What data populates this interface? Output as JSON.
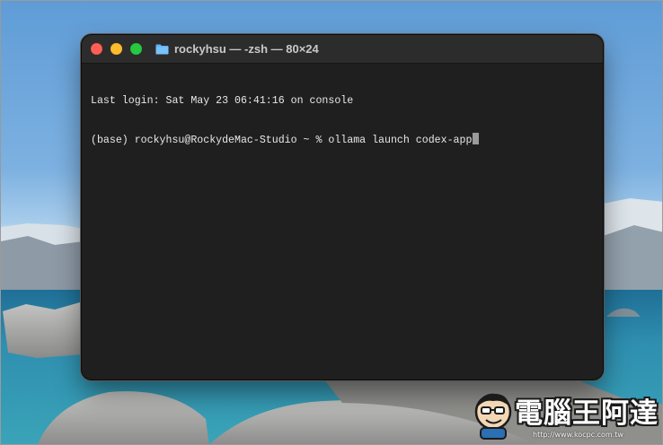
{
  "terminal": {
    "title": "rockyhsu — -zsh — 80×24",
    "lines": [
      "Last login: Sat May 23 06:41:16 on console",
      "(base) rockyhsu@RockydeMac-Studio ~ % ollama launch codex-app"
    ],
    "cursor": "block"
  },
  "watermark": {
    "brand": "電腦王阿達",
    "url": "http://www.kocpc.com.tw"
  },
  "icons": {
    "close": "close-traffic-light",
    "minimize": "minimize-traffic-light",
    "zoom": "zoom-traffic-light",
    "title": "folder-icon",
    "watermark": "mascot-logo"
  },
  "colors": {
    "close": "#fe5f57",
    "minimize": "#febc2e",
    "zoom": "#28c840",
    "terminal_bg": "#1f1f1f",
    "folder": "#5eb3f5"
  }
}
